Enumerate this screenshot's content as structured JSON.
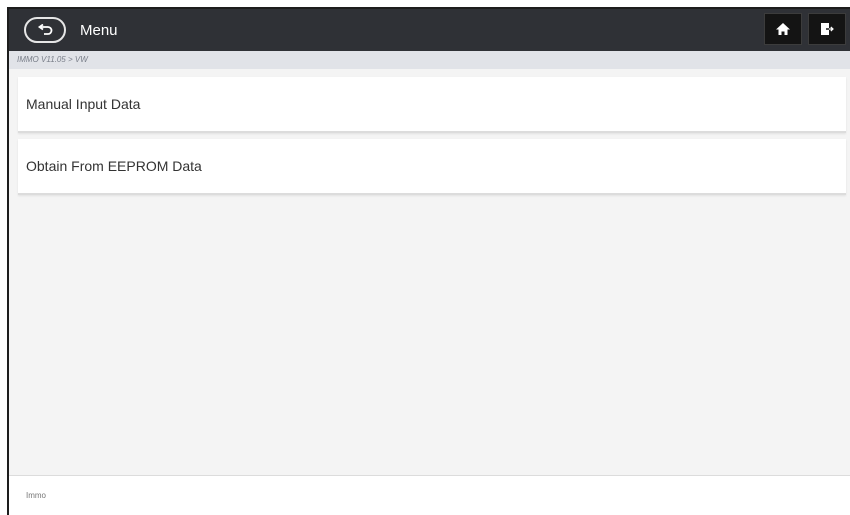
{
  "titlebar": {
    "title": "Menu",
    "back_icon": "back-arrow-icon",
    "home_icon": "home-icon",
    "exit_icon": "exit-icon"
  },
  "breadcrumb": "IMMO V11.05 > VW",
  "menu": {
    "items": [
      {
        "label": "Manual Input Data"
      },
      {
        "label": "Obtain From EEPROM Data"
      }
    ]
  },
  "footer": {
    "label": "Immo"
  }
}
